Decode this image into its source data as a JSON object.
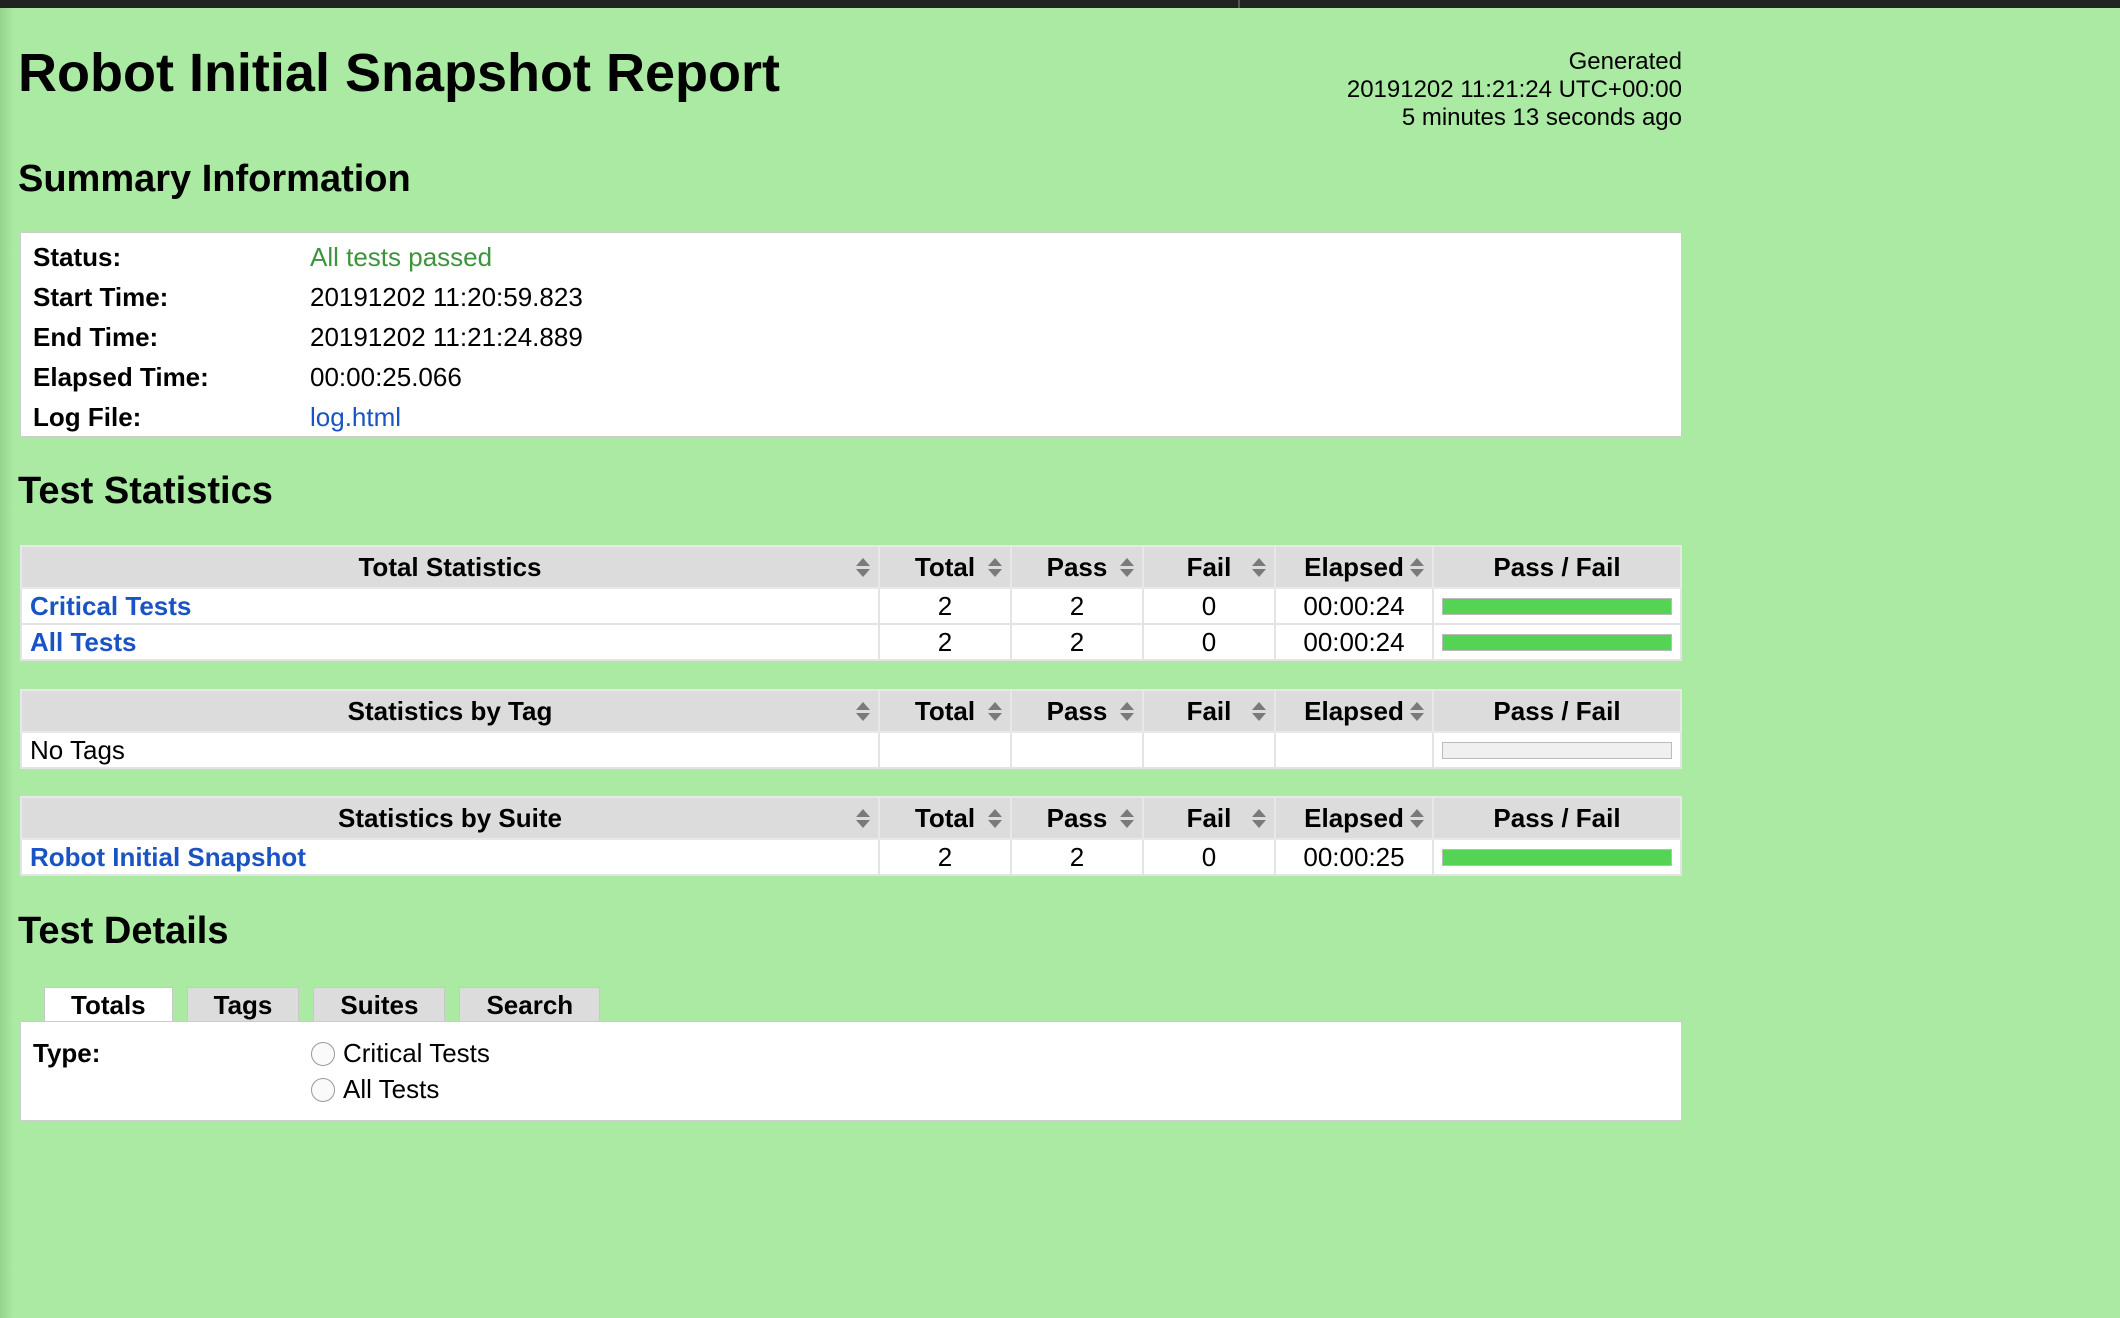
{
  "page": {
    "title": "Robot Initial Snapshot Report",
    "generated_label": "Generated",
    "generated_time": "20191202 11:21:24 UTC+00:00",
    "generated_ago": "5 minutes 13 seconds ago"
  },
  "summary": {
    "heading": "Summary Information",
    "rows": [
      {
        "key": "Status:",
        "value": "All tests passed"
      },
      {
        "key": "Start Time:",
        "value": "20191202 11:20:59.823"
      },
      {
        "key": "End Time:",
        "value": "20191202 11:21:24.889"
      },
      {
        "key": "Elapsed Time:",
        "value": "00:00:25.066"
      },
      {
        "key": "Log File:",
        "value": "log.html"
      }
    ]
  },
  "statistics": {
    "heading": "Test Statistics",
    "columns": [
      "Total",
      "Pass",
      "Fail",
      "Elapsed",
      "Pass / Fail"
    ],
    "total": {
      "header": "Total Statistics",
      "rows": [
        {
          "name": "Critical Tests",
          "total": "2",
          "pass": "2",
          "fail": "0",
          "elapsed": "00:00:24",
          "pass_fraction": 1.0
        },
        {
          "name": "All Tests",
          "total": "2",
          "pass": "2",
          "fail": "0",
          "elapsed": "00:00:24",
          "pass_fraction": 1.0
        }
      ]
    },
    "tag": {
      "header": "Statistics by Tag",
      "rows": [
        {
          "name": "No Tags",
          "total": "",
          "pass": "",
          "fail": "",
          "elapsed": "",
          "pass_fraction": 0
        }
      ]
    },
    "suite": {
      "header": "Statistics by Suite",
      "rows": [
        {
          "name": "Robot Initial Snapshot",
          "total": "2",
          "pass": "2",
          "fail": "0",
          "elapsed": "00:00:25",
          "pass_fraction": 1.0
        }
      ]
    }
  },
  "details": {
    "heading": "Test Details",
    "tabs": [
      "Totals",
      "Tags",
      "Suites",
      "Search"
    ],
    "active_tab": "Totals",
    "type_label": "Type:",
    "options": [
      "Critical Tests",
      "All Tests"
    ]
  },
  "colors": {
    "background": "#abeaa3",
    "pass": "#55d355",
    "link": "#1a54c4",
    "status_pass_text": "#3d943d"
  }
}
